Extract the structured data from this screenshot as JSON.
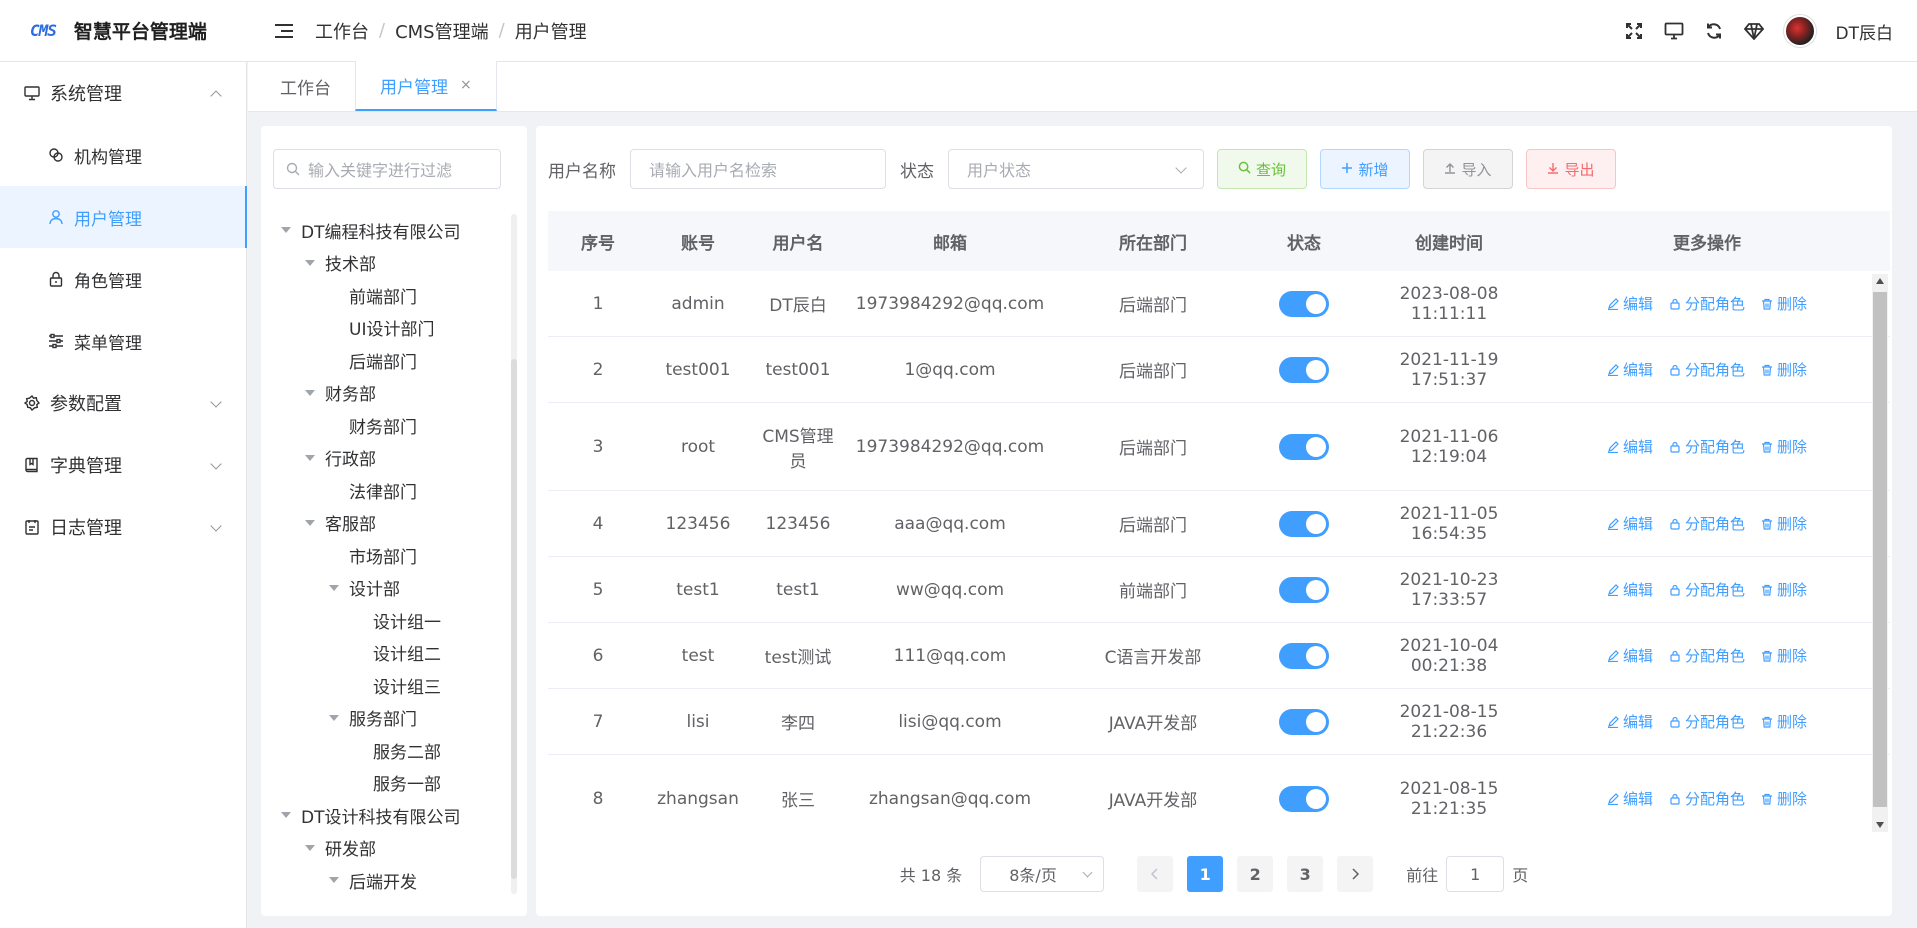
{
  "app": {
    "logo_mark": "CMS",
    "title": "智慧平台管理端"
  },
  "header": {
    "breadcrumb": [
      "工作台",
      "CMS管理端",
      "用户管理"
    ],
    "username": "DT辰白"
  },
  "sidebar": {
    "groups": [
      {
        "label": "系统管理",
        "icon": "monitor-icon",
        "expanded": true,
        "items": [
          {
            "label": "机构管理",
            "icon": "link-icon"
          },
          {
            "label": "用户管理",
            "icon": "user-icon",
            "active": true
          },
          {
            "label": "角色管理",
            "icon": "lock-icon"
          },
          {
            "label": "菜单管理",
            "icon": "sliders-icon"
          }
        ]
      },
      {
        "label": "参数配置",
        "icon": "gear-icon",
        "expanded": false
      },
      {
        "label": "字典管理",
        "icon": "book-icon",
        "expanded": false
      },
      {
        "label": "日志管理",
        "icon": "log-icon",
        "expanded": false
      }
    ]
  },
  "tabs": [
    {
      "label": "工作台",
      "active": false
    },
    {
      "label": "用户管理",
      "active": true,
      "close": "×"
    }
  ],
  "tree": {
    "placeholder": "输入关键字进行过滤",
    "nodes": [
      {
        "label": "DT编程科技有限公司",
        "level": 0,
        "arrow": true
      },
      {
        "label": "技术部",
        "level": 1,
        "arrow": true
      },
      {
        "label": "前端部门",
        "level": 2,
        "arrow": false
      },
      {
        "label": "UI设计部门",
        "level": 2,
        "arrow": false
      },
      {
        "label": "后端部门",
        "level": 2,
        "arrow": false
      },
      {
        "label": "财务部",
        "level": 1,
        "arrow": true
      },
      {
        "label": "财务部门",
        "level": 2,
        "arrow": false
      },
      {
        "label": "行政部",
        "level": 1,
        "arrow": true
      },
      {
        "label": "法律部门",
        "level": 2,
        "arrow": false
      },
      {
        "label": "客服部",
        "level": 1,
        "arrow": true
      },
      {
        "label": "市场部门",
        "level": 2,
        "arrow": false
      },
      {
        "label": "设计部",
        "level": 2,
        "arrow": true
      },
      {
        "label": "设计组一",
        "level": 3,
        "arrow": false
      },
      {
        "label": "设计组二",
        "level": 3,
        "arrow": false
      },
      {
        "label": "设计组三",
        "level": 3,
        "arrow": false
      },
      {
        "label": "服务部门",
        "level": 2,
        "arrow": true
      },
      {
        "label": "服务二部",
        "level": 3,
        "arrow": false
      },
      {
        "label": "服务一部",
        "level": 3,
        "arrow": false
      },
      {
        "label": "DT设计科技有限公司",
        "level": 0,
        "arrow": true
      },
      {
        "label": "研发部",
        "level": 1,
        "arrow": true
      },
      {
        "label": "后端开发",
        "level": 2,
        "arrow": true
      }
    ]
  },
  "search": {
    "username_label": "用户名称",
    "username_placeholder": "请输入用户名检索",
    "status_label": "状态",
    "status_placeholder": "用户状态",
    "query": "查询",
    "add": "新增",
    "import": "导入",
    "export": "导出"
  },
  "table": {
    "columns": [
      "序号",
      "账号",
      "用户名",
      "邮箱",
      "所在部门",
      "状态",
      "创建时间",
      "更多操作"
    ],
    "actions": {
      "edit": "编辑",
      "assign": "分配角色",
      "delete": "删除"
    },
    "rows": [
      {
        "idx": "1",
        "account": "admin",
        "name": "DT辰白",
        "email": "1973984292@qq.com",
        "dept": "后端部门",
        "status": true,
        "created": "2023-08-08 11:11:11"
      },
      {
        "idx": "2",
        "account": "test001",
        "name": "test001",
        "email": "1@qq.com",
        "dept": "后端部门",
        "status": true,
        "created": "2021-11-19 17:51:37"
      },
      {
        "idx": "3",
        "account": "root",
        "name": "CMS管理员",
        "email": "1973984292@qq.com",
        "dept": "后端部门",
        "status": true,
        "created": "2021-11-06 12:19:04"
      },
      {
        "idx": "4",
        "account": "123456",
        "name": "123456",
        "email": "aaa@qq.com",
        "dept": "后端部门",
        "status": true,
        "created": "2021-11-05 16:54:35"
      },
      {
        "idx": "5",
        "account": "test1",
        "name": "test1",
        "email": "ww@qq.com",
        "dept": "前端部门",
        "status": true,
        "created": "2021-10-23 17:33:57"
      },
      {
        "idx": "6",
        "account": "test",
        "name": "test测试",
        "email": "111@qq.com",
        "dept": "C语言开发部",
        "status": true,
        "created": "2021-10-04 00:21:38"
      },
      {
        "idx": "7",
        "account": "lisi",
        "name": "李四",
        "email": "lisi@qq.com",
        "dept": "JAVA开发部",
        "status": true,
        "created": "2021-08-15 21:22:36"
      },
      {
        "idx": "8",
        "account": "zhangsan",
        "name": "张三",
        "email": "zhangsan@qq.com",
        "dept": "JAVA开发部",
        "status": true,
        "created": "2021-08-15 21:21:35"
      }
    ]
  },
  "pagination": {
    "total": "共 18 条",
    "page_size": "8条/页",
    "pages": [
      "1",
      "2",
      "3"
    ],
    "current": "1",
    "goto_prefix": "前往",
    "goto_value": "1",
    "goto_suffix": "页"
  },
  "colors": {
    "primary": "#409eff",
    "success": "#67c23a",
    "danger": "#f56c6c",
    "info": "#909399"
  }
}
